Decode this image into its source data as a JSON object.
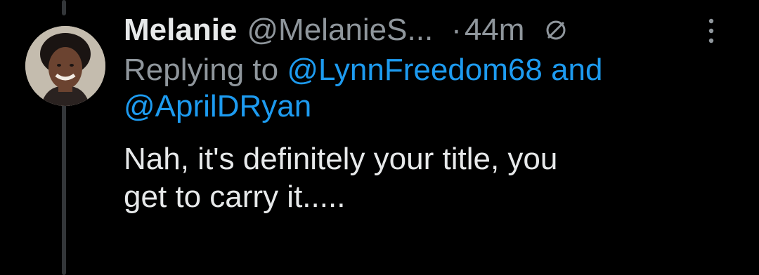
{
  "tweet": {
    "display_name": "Melanie",
    "handle": "@MelanieS...",
    "separator": "·",
    "time": "44m",
    "mute_icon": "muted-slash-circle-icon",
    "more_icon": "more-vertical-icon",
    "replying_label": "Replying to",
    "mention_1": "@LynnFreedom68",
    "and_label": "and",
    "mention_2": "@AprilDRyan",
    "text_line_1": "Nah, it's definitely your title, you",
    "text_line_2": "get to carry it....."
  },
  "colors": {
    "background": "#000000",
    "text": "#e7e9ea",
    "secondary": "#8f969c",
    "link": "#1d9bf0",
    "thread_line": "#333639"
  }
}
